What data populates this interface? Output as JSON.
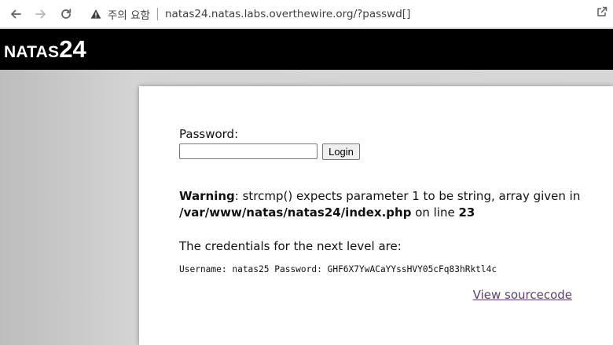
{
  "browser": {
    "security_label": "주의 요함",
    "url": "natas24.natas.labs.overthewire.org/?passwd[]",
    "icons": {
      "back": "arrow-left-icon",
      "forward": "arrow-right-icon",
      "reload": "reload-icon",
      "security": "warning-triangle-icon",
      "share": "share-icon"
    }
  },
  "header": {
    "site_prefix": "NATAS",
    "level": "24"
  },
  "form": {
    "password_label": "Password:",
    "password_value": "",
    "login_label": "Login"
  },
  "warning": {
    "label": "Warning",
    "message_1": ": strcmp() expects parameter 1 to be string, array given in",
    "file_path": "/var/www/natas/natas24/index.php",
    "on_line_text": " on line ",
    "line_number": "23"
  },
  "credentials": {
    "intro": "The credentials for the next level are:",
    "line": "Username: natas25 Password: GHF6X7YwACaYYssHVY05cFq83hRktl4c"
  },
  "links": {
    "view_source": "View sourcecode"
  },
  "colors": {
    "header_bg": "#000000",
    "page_bg": "#d6d6d6",
    "link_visited": "#5a3d7a"
  }
}
